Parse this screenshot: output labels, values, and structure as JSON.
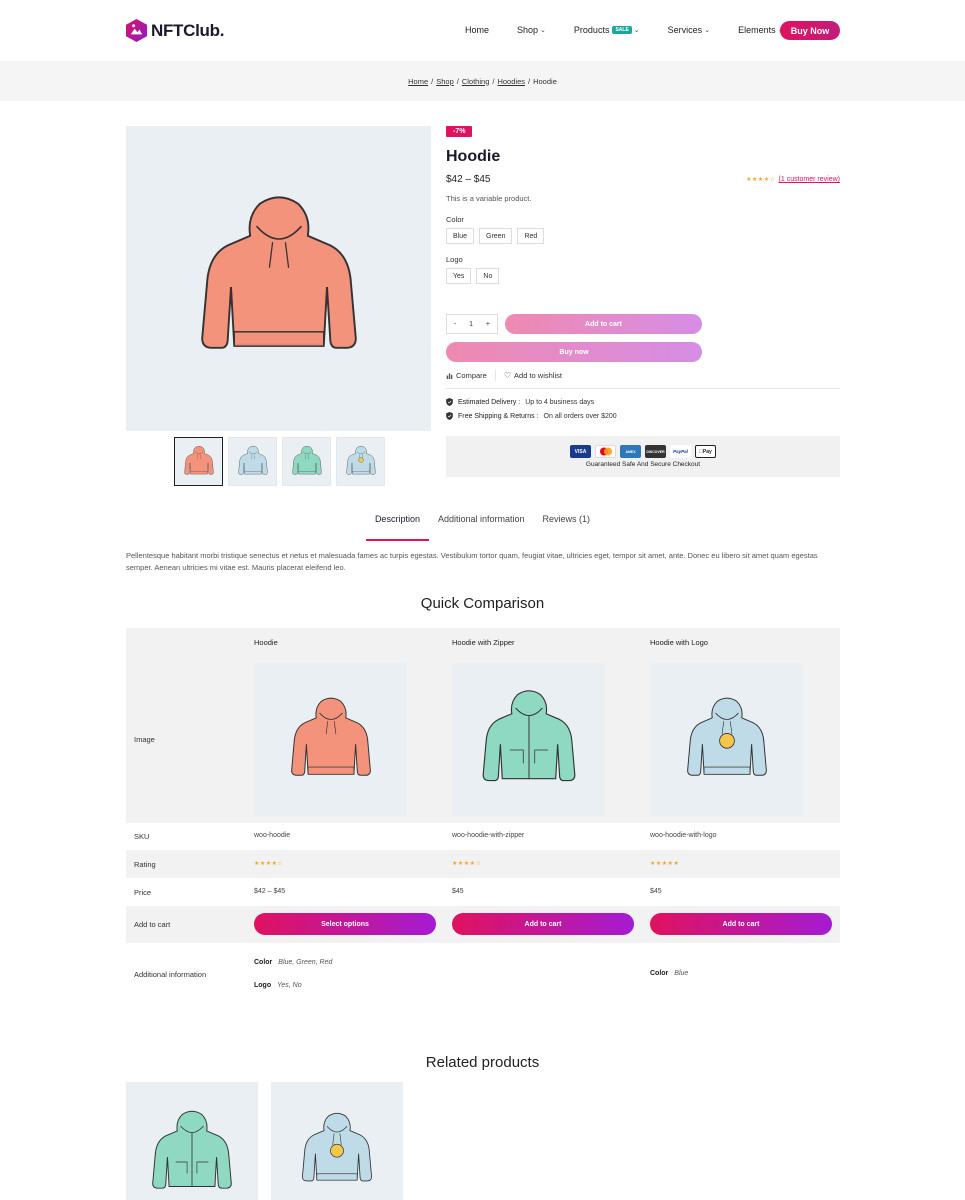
{
  "brand": {
    "name": "NFTClub."
  },
  "nav": {
    "items": [
      {
        "label": "Home",
        "dropdown": false
      },
      {
        "label": "Shop",
        "dropdown": true
      },
      {
        "label": "Products",
        "dropdown": true,
        "badge": "SALE"
      },
      {
        "label": "Services",
        "dropdown": true
      },
      {
        "label": "Elements",
        "dropdown": true
      }
    ],
    "cta": "Buy Now"
  },
  "breadcrumb": {
    "links": [
      "Home",
      "Shop",
      "Clothing",
      "Hoodies"
    ],
    "current": "Hoodie",
    "separator": "/"
  },
  "product": {
    "sale_badge": "-7%",
    "title": "Hoodie",
    "price": "$42 – $45",
    "rating": 4,
    "review_link": "(1 customer review)",
    "short_description": "This is a variable product.",
    "attributes": [
      {
        "label": "Color",
        "options": [
          "Blue",
          "Green",
          "Red"
        ]
      },
      {
        "label": "Logo",
        "options": [
          "Yes",
          "No"
        ]
      }
    ],
    "quantity": {
      "minus": "-",
      "value": "1",
      "plus": "+"
    },
    "add_to_cart": "Add to cart",
    "buy_now": "Buy now",
    "compare": "Compare",
    "wishlist": "Add to wishlist",
    "delivery_label": "Estimated Delivery :",
    "delivery_value": "Up to 4 business days",
    "shipping_label": "Free Shipping & Returns :",
    "shipping_value": "On all orders over $200",
    "payment_methods": [
      "VISA",
      "Mastercard",
      "AMEX",
      "DISCOVER",
      "PayPal",
      "Pay"
    ],
    "safe_checkout": "Guaranteed Safe And Secure Checkout",
    "thumbnails": [
      "hoodie-red",
      "hoodie-blue",
      "hoodie-green",
      "hoodie-blue-logo"
    ]
  },
  "tabs": {
    "items": [
      "Description",
      "Additional information",
      "Reviews (1)"
    ],
    "active": 0,
    "description": "Pellentesque habitant morbi tristique senectus et netus et malesuada fames ac turpis egestas. Vestibulum tortor quam, feugiat vitae, ultricies eget, tempor sit amet, ante. Donec eu libero sit amet quam egestas semper. Aenean ultricies mi vitae est. Mauris placerat eleifend leo."
  },
  "comparison": {
    "title": "Quick Comparison",
    "row_labels": {
      "image": "Image",
      "sku": "SKU",
      "rating": "Rating",
      "price": "Price",
      "add_to_cart": "Add to cart",
      "additional": "Additional information"
    },
    "products": [
      {
        "name": "Hoodie",
        "sku": "woo-hoodie",
        "rating": 4,
        "price": "$42 – $45",
        "button": "Select options",
        "attrs": [
          {
            "key": "Color",
            "value": "Blue, Green, Red"
          },
          {
            "key": "Logo",
            "value": "Yes, No"
          }
        ]
      },
      {
        "name": "Hoodie with Zipper",
        "sku": "woo-hoodie-with-zipper",
        "rating": 4,
        "price": "$45",
        "button": "Add to cart",
        "attrs": []
      },
      {
        "name": "Hoodie with Logo",
        "sku": "woo-hoodie-with-logo",
        "rating": 5,
        "price": "$45",
        "button": "Add to cart",
        "attrs": [
          {
            "key": "Color",
            "value": "Blue"
          }
        ]
      }
    ]
  },
  "related": {
    "title": "Related products"
  },
  "colors": {
    "accent": "#e0125f",
    "accent2": "#a51bd3",
    "star": "#f5a623",
    "hoodie_red": "#f4937c",
    "hoodie_green": "#8fd8c2",
    "hoodie_blue": "#bfdbe8"
  }
}
